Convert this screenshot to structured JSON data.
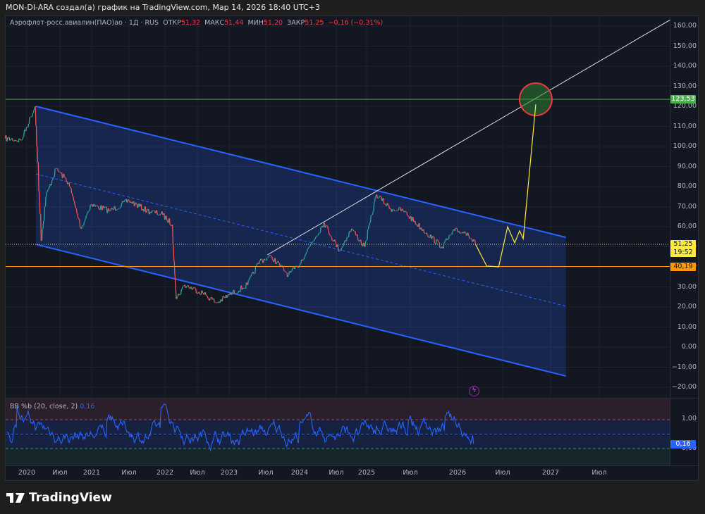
{
  "credit": "MON-DI-ARA создал(а) график на TradingView.com, Мар 14, 2026 18:40 UTC+3",
  "legend": {
    "symbol": "Аэрофлот-росс.авиалин(ПАО)ао · 1Д · RUS",
    "open_label": "ОТКР",
    "open": "51,32",
    "high_label": "МАКС",
    "high": "51,44",
    "low_label": "МИН",
    "low": "51,20",
    "close_label": "ЗАКР",
    "close": "51,25",
    "change": "−0,16 (−0,31%)"
  },
  "indicator": {
    "name": "BB %b (20, close, 2)",
    "value": "0,16",
    "scale": [
      "1,00",
      "0,00"
    ],
    "current_tag": "0,16"
  },
  "price_axis": [
    "160,00",
    "150,00",
    "140,00",
    "130,00",
    "120,00",
    "110,00",
    "100,00",
    "90,00",
    "80,00",
    "70,00",
    "60,00",
    "50,00",
    "40,00",
    "30,00",
    "20,00",
    "10,00",
    "0,00",
    "−10,00",
    "−20,00"
  ],
  "tags": {
    "green_level": "123,53",
    "last_price": "51,25",
    "countdown": "19:52",
    "orange_level": "40,19"
  },
  "time_axis": [
    "2020",
    "Июл",
    "2021",
    "Июл",
    "2022",
    "Июл",
    "2023",
    "Июл",
    "2024",
    "Июл",
    "2025",
    "Июл",
    "2026",
    "Июл",
    "2027",
    "Июл"
  ],
  "brand": "TradingView",
  "colors": {
    "up": "#26a69a",
    "down": "#ef5350",
    "channel": "#2962ff",
    "projection": "#ffeb3b",
    "green_level": "#4caf50",
    "orange_level": "#ff9800",
    "indicator": "#2962ff"
  },
  "chart_data": {
    "type": "line",
    "ylim": [
      -20,
      160
    ],
    "price": [
      [
        "2019-09-01",
        104
      ],
      [
        "2019-12-01",
        103
      ],
      [
        "2020-02-15",
        120
      ],
      [
        "2020-03-01",
        92
      ],
      [
        "2020-03-20",
        53
      ],
      [
        "2020-04-15",
        75
      ],
      [
        "2020-06-10",
        89
      ],
      [
        "2020-08-20",
        82
      ],
      [
        "2020-11-01",
        59
      ],
      [
        "2020-12-25",
        71
      ],
      [
        "2021-04-01",
        68
      ],
      [
        "2021-07-01",
        73
      ],
      [
        "2021-10-01",
        68
      ],
      [
        "2021-12-20",
        66
      ],
      [
        "2022-02-10",
        61
      ],
      [
        "2022-02-25",
        36
      ],
      [
        "2022-03-05",
        24
      ],
      [
        "2022-04-20",
        31
      ],
      [
        "2022-08-01",
        27
      ],
      [
        "2022-10-20",
        22
      ],
      [
        "2023-01-01",
        26
      ],
      [
        "2023-04-01",
        31
      ],
      [
        "2023-06-01",
        43
      ],
      [
        "2023-08-01",
        45
      ],
      [
        "2023-11-01",
        36
      ],
      [
        "2023-12-20",
        40
      ],
      [
        "2024-03-01",
        52
      ],
      [
        "2024-05-01",
        62
      ],
      [
        "2024-07-20",
        48
      ],
      [
        "2024-10-01",
        59
      ],
      [
        "2024-12-20",
        50
      ],
      [
        "2025-02-10",
        76
      ],
      [
        "2025-04-10",
        69
      ],
      [
        "2025-06-01",
        68
      ],
      [
        "2025-09-01",
        57
      ],
      [
        "2025-11-01",
        50
      ],
      [
        "2025-12-20",
        58
      ],
      [
        "2026-02-10",
        57
      ],
      [
        "2026-03-14",
        51.25
      ]
    ],
    "projection": [
      [
        "2026-03-14",
        51.25
      ],
      [
        "2026-04-28",
        40.4
      ],
      [
        "2026-06-15",
        40
      ],
      [
        "2026-07-20",
        60
      ],
      [
        "2026-08-16",
        52
      ],
      [
        "2026-09-04",
        58
      ],
      [
        "2026-09-18",
        54
      ],
      [
        "2026-11-05",
        121
      ]
    ],
    "channel": {
      "upper": [
        [
          "2020-02-20",
          120
        ],
        [
          "2027-02-27",
          54.7
        ]
      ],
      "middle": [
        [
          "2020-02-20",
          86.3
        ],
        [
          "2027-02-27",
          20.4
        ]
      ],
      "lower": [
        [
          "2020-02-20",
          51.2
        ],
        [
          "2027-02-27",
          -14.4
        ]
      ]
    },
    "trendline": [
      [
        "2023-07-10",
        46
      ],
      [
        "2028-03-20",
        163
      ]
    ],
    "horizontal_levels": [
      123.53,
      40.19
    ],
    "last_price": 51.25,
    "target_circle": [
      "2026-11-05",
      123.5
    ]
  }
}
